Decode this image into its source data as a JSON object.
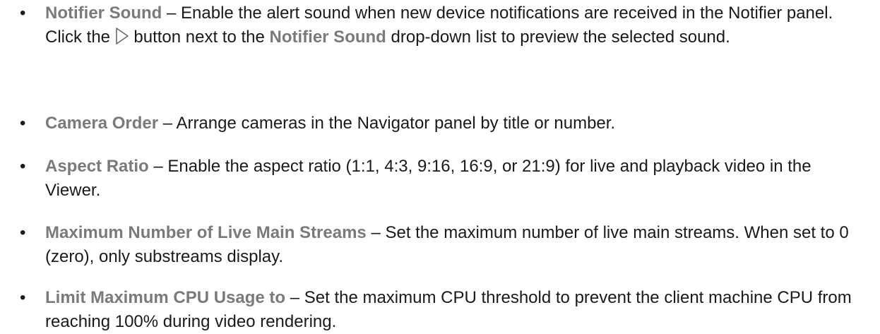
{
  "items": [
    {
      "term": "Notifier Sound",
      "text_1": " – Enable the alert sound when new device notifications are received in the Notifier panel. Click the ",
      "icon": "play-icon",
      "text_2": " button next to the ",
      "term_2": "Notifier Sound",
      "text_3": " drop-down list to preview the selected sound."
    },
    {
      "term": "Camera Order",
      "text": " – Arrange cameras in the Navigator panel by title or number."
    },
    {
      "term": "Aspect Ratio",
      "text": " – Enable the aspect ratio (1:1, 4:3, 9:16, 16:9, or 21:9) for live and playback video in the Viewer."
    },
    {
      "term": "Maximum Number of Live Main Streams",
      "text": " – Set the maximum number of live main streams. When set to 0 (zero), only substreams display."
    },
    {
      "term": "Limit Maximum CPU Usage to",
      "text": " – Set the maximum CPU threshold to prevent the client machine CPU from reaching 100% during video rendering."
    }
  ],
  "bullet_char": "•",
  "colors": {
    "term": "#7a7a7a",
    "body": "#1a1a1a"
  }
}
